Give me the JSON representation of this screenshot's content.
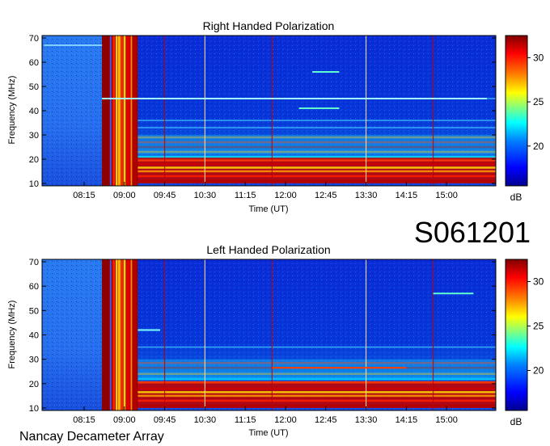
{
  "figure": {
    "station_label": "Nancay Decameter Array",
    "observation_id": "S061201"
  },
  "chart_data": [
    {
      "type": "heatmap",
      "title": "Right Handed Polarization",
      "xlabel": "Time (UT)",
      "ylabel": "Frequency (MHz)",
      "x_ticks": [
        "08:15",
        "09:00",
        "09:45",
        "10:30",
        "11:15",
        "12:00",
        "12:45",
        "13:30",
        "14:15",
        "15:00"
      ],
      "y_ticks": [
        10,
        20,
        30,
        40,
        50,
        60,
        70
      ],
      "ylim": [
        9,
        71
      ],
      "colorbar": {
        "label": "dB",
        "ticks": [
          20,
          25,
          30
        ],
        "range": [
          15.5,
          32.5
        ]
      },
      "colormap": [
        "#00008f",
        "#0000ff",
        "#0080ff",
        "#00ffff",
        "#80ff80",
        "#ffff00",
        "#ff8000",
        "#ff0000",
        "#800000"
      ],
      "interference_bands_mhz": [
        11,
        13,
        15,
        16.5,
        18,
        19.5,
        21,
        23,
        25,
        27,
        29,
        33,
        36,
        45
      ],
      "burst_time_range": [
        "08:35",
        "09:15"
      ],
      "bright_features": [
        {
          "freq_mhz": 45,
          "span": [
            "08:35",
            "15:45"
          ],
          "color": "#a0ffff"
        },
        {
          "freq_mhz": 67,
          "span": [
            "07:30",
            "08:35"
          ],
          "color": "#80d0ff"
        },
        {
          "freq_mhz": 41,
          "span": [
            "12:15",
            "13:00"
          ],
          "color": "#60ffd0"
        },
        {
          "freq_mhz": 56,
          "span": [
            "12:30",
            "13:00"
          ],
          "color": "#60ffd0"
        }
      ]
    },
    {
      "type": "heatmap",
      "title": "Left Handed Polarization",
      "xlabel": "Time (UT)",
      "ylabel": "Frequency (MHz)",
      "x_ticks": [
        "08:15",
        "09:00",
        "09:45",
        "10:30",
        "11:15",
        "12:00",
        "12:45",
        "13:30",
        "14:15",
        "15:00"
      ],
      "y_ticks": [
        10,
        20,
        30,
        40,
        50,
        60,
        70
      ],
      "ylim": [
        9,
        71
      ],
      "colorbar": {
        "label": "dB",
        "ticks": [
          20,
          25,
          30
        ],
        "range": [
          15.5,
          32.5
        ]
      },
      "colormap": [
        "#00008f",
        "#0000ff",
        "#0080ff",
        "#00ffff",
        "#80ff80",
        "#ffff00",
        "#ff8000",
        "#ff0000",
        "#800000"
      ],
      "interference_bands_mhz": [
        11,
        13,
        15,
        16.5,
        18,
        20.5,
        22,
        24,
        26.5,
        28.5,
        35
      ],
      "burst_time_range": [
        "08:35",
        "09:15"
      ],
      "bright_features": [
        {
          "freq_mhz": 42,
          "span": [
            "09:15",
            "09:40"
          ],
          "color": "#80ffff"
        },
        {
          "freq_mhz": 26.5,
          "span": [
            "11:45",
            "14:15"
          ],
          "color": "#ff4000"
        },
        {
          "freq_mhz": 57,
          "span": [
            "14:45",
            "15:30"
          ],
          "color": "#60ffd0"
        }
      ]
    }
  ]
}
